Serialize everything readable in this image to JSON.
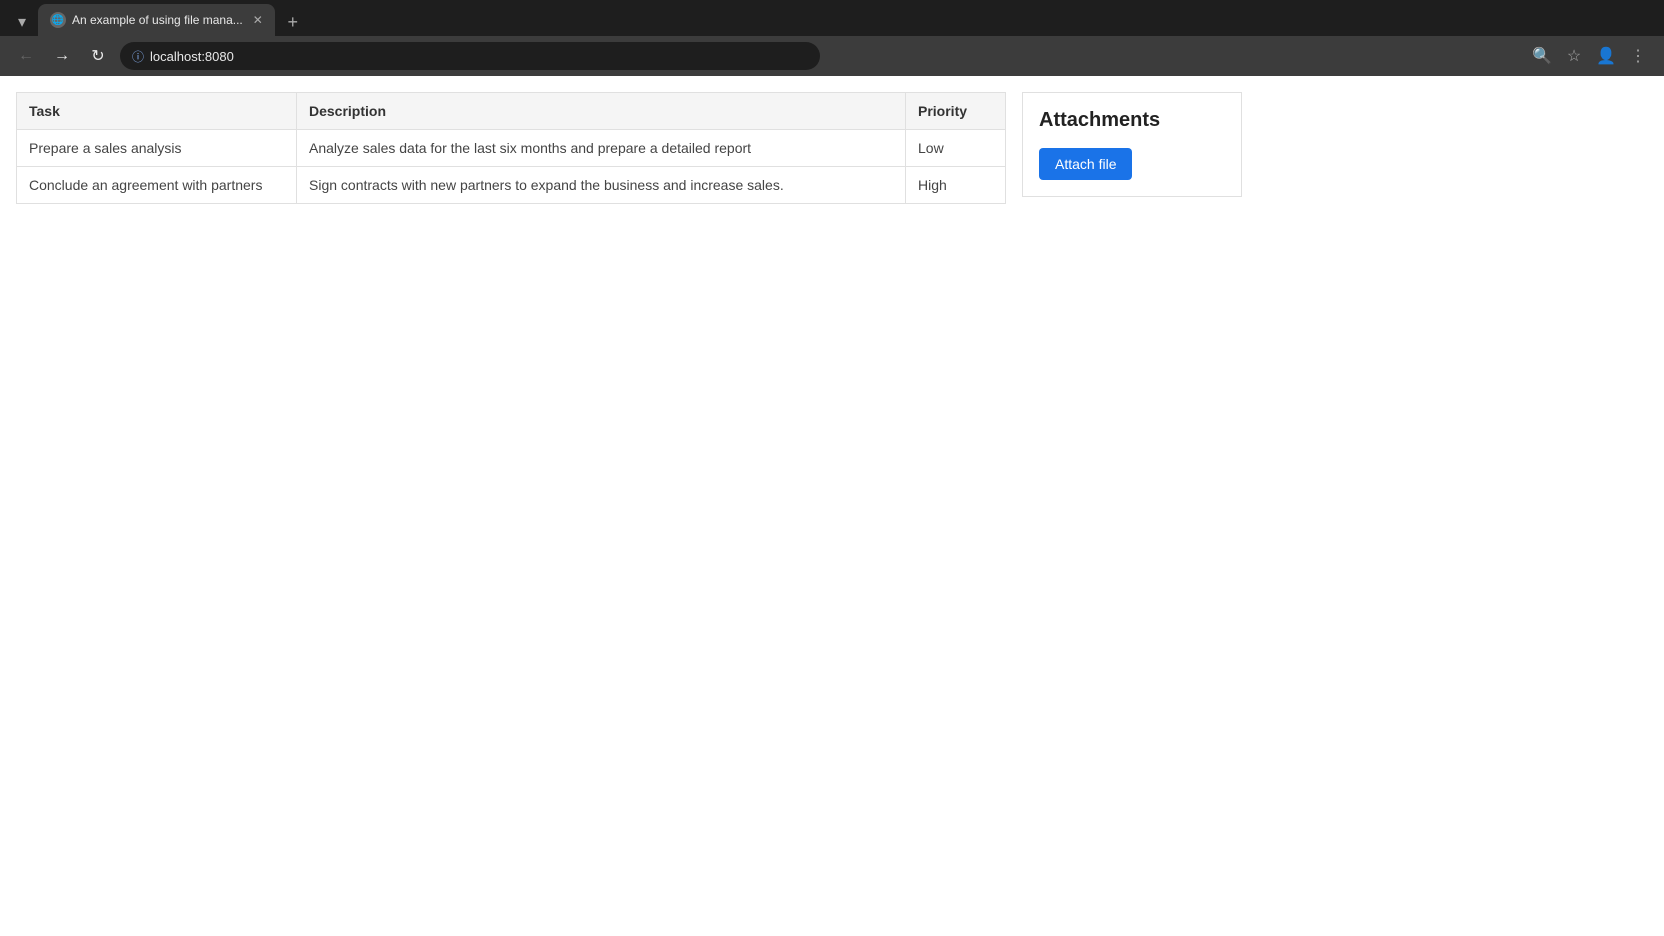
{
  "browser": {
    "tab": {
      "title": "An example of using file mana...",
      "favicon_label": "e"
    },
    "new_tab_label": "+",
    "address": "localhost:8080",
    "tab_list_icon": "▾"
  },
  "table": {
    "columns": [
      "Task",
      "Description",
      "Priority"
    ],
    "rows": [
      {
        "task": "Prepare a sales analysis",
        "description": "Analyze sales data for the last six months and prepare a detailed report",
        "priority": "Low"
      },
      {
        "task": "Conclude an agreement with partners",
        "description": "Sign contracts with new partners to expand the business and increase sales.",
        "priority": "High"
      }
    ]
  },
  "attachments": {
    "title": "Attachments",
    "attach_button_label": "Attach file"
  }
}
